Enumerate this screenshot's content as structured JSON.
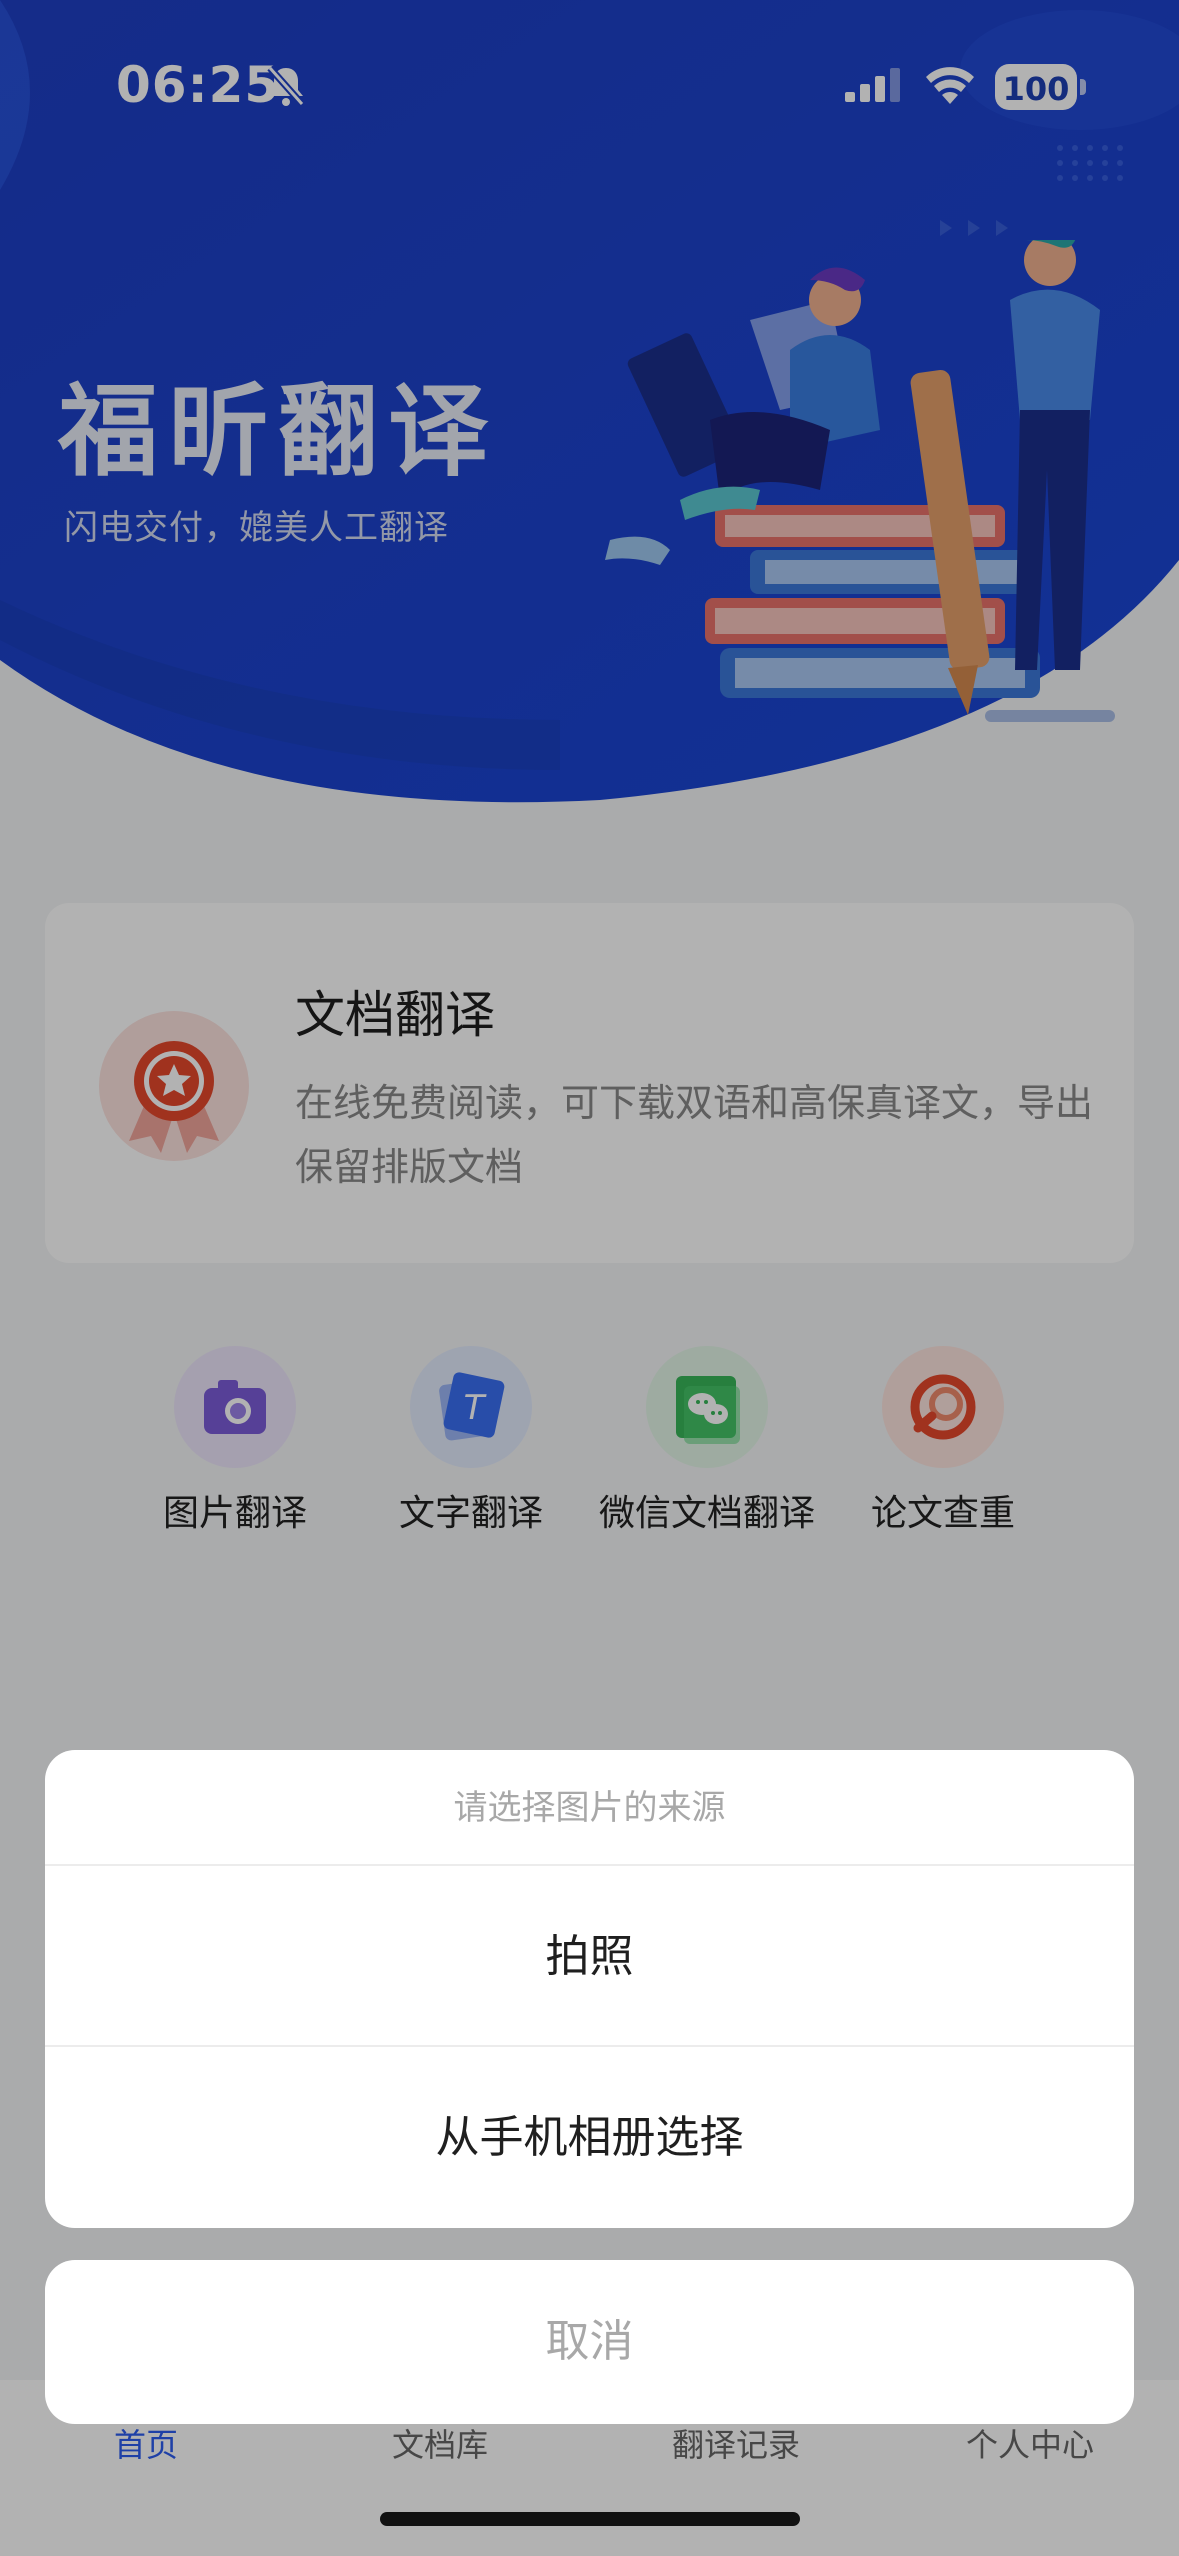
{
  "status_bar": {
    "time": "06:25",
    "battery": "100"
  },
  "hero": {
    "title": "福昕翻译",
    "subtitle": "闪电交付，媲美人工翻译"
  },
  "doc_card": {
    "title": "文档翻译",
    "description": "在线免费阅读，可下载双语和高保真译文，导出保留排版文档",
    "icon": "award-badge-icon"
  },
  "tools": [
    {
      "label": "图片翻译",
      "icon": "camera-icon",
      "color": "#7c5cd8"
    },
    {
      "label": "文字翻译",
      "icon": "text-t-icon",
      "color": "#3a6ff2"
    },
    {
      "label": "微信文档翻译",
      "icon": "wechat-doc-icon",
      "color": "#39b65a"
    },
    {
      "label": "论文查重",
      "icon": "paper-check-icon",
      "color": "#e5482c"
    }
  ],
  "tabbar": {
    "tabs": [
      "首页",
      "文档库",
      "翻译记录",
      "个人中心"
    ],
    "active": "首页"
  },
  "action_sheet": {
    "title": "请选择图片的来源",
    "options": [
      "拍照",
      "从手机相册选择"
    ],
    "cancel": "取消"
  }
}
